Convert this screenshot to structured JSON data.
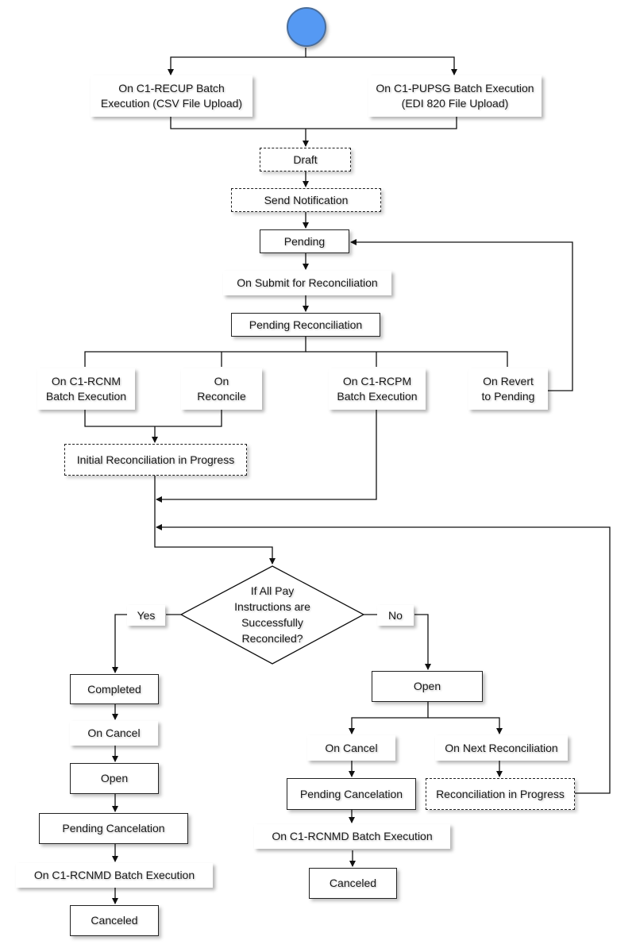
{
  "diagram": {
    "start": {
      "label": "",
      "color": "#5599f3"
    },
    "events": {
      "recup": "On C1-RECUP Batch\nExecution (CSV File Upload)",
      "pupsg": "On C1-PUPSG Batch Execution\n(EDI 820 File Upload)",
      "submit": "On Submit for Reconciliation",
      "rcnm": "On C1-RCNM\nBatch Execution",
      "reconcile": "On\nReconcile",
      "rcpm": "On C1-RCPM\nBatch Execution",
      "revert": "On Revert\nto Pending",
      "yes": "Yes",
      "no": "No",
      "cancel_left": "On Cancel",
      "rcnmd_left": "On C1-RCNMD Batch Execution",
      "cancel_right": "On Cancel",
      "next_recon": "On Next Reconciliation",
      "rcnmd_right": "On C1-RCNMD Batch Execution"
    },
    "states": {
      "draft": "Draft",
      "send_notification": "Send Notification",
      "pending": "Pending",
      "pending_recon": "Pending Reconciliation",
      "initial_recon": "Initial Reconciliation in Progress",
      "completed": "Completed",
      "open_left": "Open",
      "pending_cancel_left": "Pending Cancelation",
      "canceled_left": "Canceled",
      "open_right": "Open",
      "pending_cancel_right": "Pending Cancelation",
      "recon_in_progress": "Reconciliation in Progress",
      "canceled_right": "Canceled"
    },
    "decision": "If All Pay\nInstructions are\nSuccessfully\nReconciled?"
  }
}
